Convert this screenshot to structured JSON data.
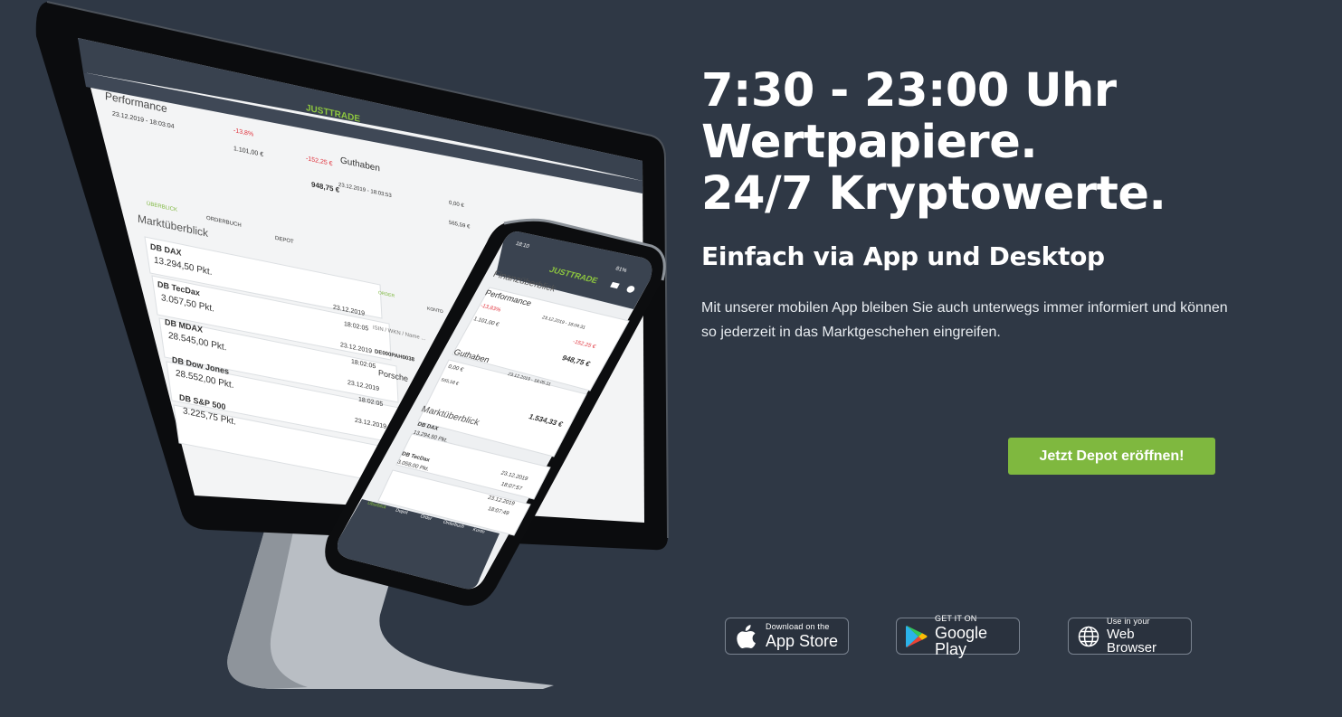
{
  "hero": {
    "headline_line1": "7:30 - 23:00 Uhr",
    "headline_line2": "Wertpapiere.",
    "headline_line3": "24/7 Kryptowerte.",
    "subheadline": "Einfach via App und Desktop",
    "body": "Mit unserer mobilen App bleiben Sie auch unterwegs immer informiert und können so jederzeit in das Marktgeschehen eingreifen.",
    "cta_label": "Jetzt Depot eröffnen!",
    "cta_color": "#7fb83f",
    "background_color": "#2f3845"
  },
  "badges": {
    "app_store": {
      "small": "Download on the",
      "big": "App Store",
      "icon": "apple-icon"
    },
    "google_play": {
      "small": "GET IT ON",
      "big": "Google Play",
      "icon": "google-play-icon"
    },
    "web_browser": {
      "small": "Use in your",
      "big": "Web Browser",
      "icon": "globe-icon"
    }
  },
  "desktop_screen": {
    "logo": "JUSTTRADE",
    "performance_title": "Performance",
    "performance_date": "23.12.2019 - 18:03:04",
    "perf_pct": "-13,8%",
    "perf_abs": "-152,25 €",
    "perf_value": "1.101,00 €",
    "perf_total": "948,75 €",
    "guthaben_title": "Guthaben",
    "guthaben_date": "23.12.2019 - 18:03:53",
    "guthaben_value": "0,00 €",
    "guthaben_total": "565,59 €",
    "tabs": [
      "ÜBERBLICK",
      "ORDERBUCH",
      "DEPOT"
    ],
    "section_title": "Marktüberblick",
    "rows": [
      {
        "name": "DB DAX",
        "value": "13.294,50 Pkt.",
        "date": "",
        "time": ""
      },
      {
        "name": "DB TecDax",
        "value": "3.057,50 Pkt.",
        "date": "23.12.2019",
        "time": "18:02:05"
      },
      {
        "name": "DB MDAX",
        "value": "28.545,00 Pkt.",
        "date": "23.12.2019",
        "time": "18:02:05"
      },
      {
        "name": "DB Dow Jones",
        "value": "28.552,00 Pkt.",
        "date": "23.12.2019",
        "time": "18:02:05"
      },
      {
        "name": "DB S&P 500",
        "value": "3.225,75 Pkt.",
        "date": "23.12.2019",
        "time": ""
      }
    ],
    "order_tabs": [
      "ORDER",
      "KONTO"
    ],
    "search_placeholder": "ISIN / WKN / Name ...",
    "isin": "DE000PAH0038",
    "stock_name": "Porsche"
  },
  "phone_screen": {
    "status_time": "18:10",
    "status_battery": "81%",
    "logo": "JUSTTRADE",
    "section_title": "Finanzüberblick",
    "performance_title": "Performance",
    "perf_pct": "-13,83%",
    "perf_value": "1.101,00 €",
    "perf_abs": "-152,25 €",
    "perf_total": "948,75 €",
    "perf_date": "23.12.2019 - 18:04:31",
    "guthaben_title": "Guthaben",
    "guthaben_date": "23.12.2019 - 18:05:11",
    "guthaben_value": "0,00 €",
    "guthaben_sub": "565,58 €",
    "guthaben_total": "1.534,33 €",
    "market_title": "Marktüberblick",
    "rows": [
      {
        "name": "DB DAX",
        "value": "13.294,50 Pkt."
      },
      {
        "name": "DB TecDax",
        "value": "3.058,00 Pkt.",
        "date": "23.12.2019",
        "time": "18:07:57"
      },
      {
        "name": "",
        "value": "",
        "date": "23.12.2019",
        "time": "18:07:49"
      }
    ],
    "nav": [
      "Überblick",
      "Depot",
      "Order",
      "Orderbuch",
      "Konto"
    ]
  }
}
